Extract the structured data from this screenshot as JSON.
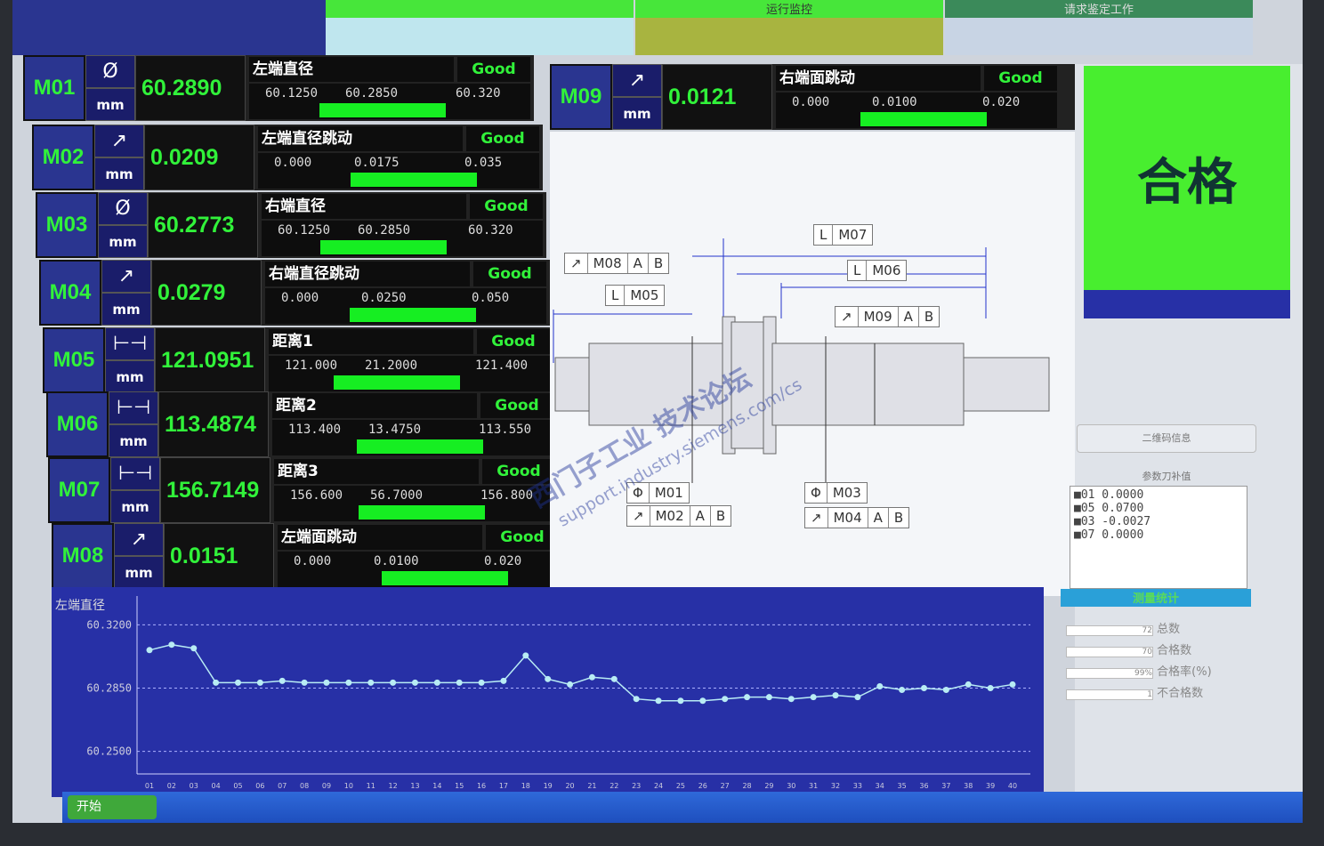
{
  "header": {
    "tabs": [
      "",
      "运行监控",
      "请求鉴定工作"
    ]
  },
  "measurements": [
    {
      "code": "M01",
      "symbol": "Ø",
      "unit": "mm",
      "value": "60.2890",
      "name": "左端直径",
      "status": "Good",
      "min": "60.1250",
      "mid": "60.2850",
      "max": "60.320",
      "indicator": 0.5
    },
    {
      "code": "M02",
      "symbol": "↗",
      "unit": "mm",
      "value": "0.0209",
      "name": "左端直径跳动",
      "status": "Good",
      "min": "0.000",
      "mid": "0.0175",
      "max": "0.035",
      "indicator": 0.58
    },
    {
      "code": "M03",
      "symbol": "Ø",
      "unit": "mm",
      "value": "60.2773",
      "name": "右端直径",
      "status": "Good",
      "min": "60.1250",
      "mid": "60.2850",
      "max": "60.320",
      "indicator": 0.46
    },
    {
      "code": "M04",
      "symbol": "↗",
      "unit": "mm",
      "value": "0.0279",
      "name": "右端直径跳动",
      "status": "Good",
      "min": "0.000",
      "mid": "0.0250",
      "max": "0.050",
      "indicator": 0.55
    },
    {
      "code": "M05",
      "symbol": "⊢⊣",
      "unit": "mm",
      "value": "121.0951",
      "name": "距离1",
      "status": "Good",
      "min": "121.000",
      "mid": "21.2000",
      "max": "121.400",
      "indicator": 0.48
    },
    {
      "code": "M06",
      "symbol": "⊢⊣",
      "unit": "mm",
      "value": "113.4874",
      "name": "距离2",
      "status": "Good",
      "min": "113.400",
      "mid": "13.4750",
      "max": "113.550",
      "indicator": 0.55
    },
    {
      "code": "M07",
      "symbol": "⊢⊣",
      "unit": "mm",
      "value": "156.7149",
      "name": "距离3",
      "status": "Good",
      "min": "156.600",
      "mid": "56.7000",
      "max": "156.800",
      "indicator": 0.55
    },
    {
      "code": "M08",
      "symbol": "↗",
      "unit": "mm",
      "value": "0.0151",
      "name": "左端面跳动",
      "status": "Good",
      "min": "0.000",
      "mid": "0.0100",
      "max": "0.020",
      "indicator": 0.62
    }
  ],
  "m09": {
    "code": "M09",
    "symbol": "↗",
    "unit": "mm",
    "value": "0.0121",
    "name": "右端面跳动",
    "status": "Good",
    "min": "0.000",
    "mid": "0.0100",
    "max": "0.020",
    "indicator": 0.55
  },
  "result": {
    "text": "合格"
  },
  "drawing_labels": {
    "m07": [
      "L",
      "M07"
    ],
    "m06": [
      "L",
      "M06"
    ],
    "m05": [
      "L",
      "M05"
    ],
    "m08": [
      "↗",
      "M08",
      "A",
      "B"
    ],
    "m09": [
      "↗",
      "M09",
      "A",
      "B"
    ],
    "m01": [
      "Φ",
      "M01"
    ],
    "m02": [
      "↗",
      "M02",
      "A",
      "B"
    ],
    "m03": [
      "Φ",
      "M03"
    ],
    "m04": [
      "↗",
      "M04",
      "A",
      "B"
    ]
  },
  "watermark": [
    "西门子工业 技术论坛",
    "support.industry.siemens.com/cs"
  ],
  "right_panel": {
    "qr_label": "二维码信息",
    "params_title": "参数刀补值",
    "params": [
      "■01  0.0000",
      "■05  0.0700",
      "■03  -0.0027",
      "■07  0.0000"
    ],
    "stats_title": "测量统计",
    "stats": [
      {
        "label": "总数",
        "value": "72"
      },
      {
        "label": "合格数",
        "value": "70"
      },
      {
        "label": "合格率(%)",
        "value": "99%"
      },
      {
        "label": "不合格数",
        "value": "1"
      }
    ]
  },
  "chart_data": {
    "type": "line",
    "title": "左端直径",
    "ylim": [
      60.24,
      60.33
    ],
    "yticks": [
      "60.3200",
      "60.2850",
      "60.2500"
    ],
    "x": [
      "01",
      "02",
      "03",
      "04",
      "05",
      "06",
      "07",
      "08",
      "09",
      "10",
      "11",
      "12",
      "13",
      "14",
      "15",
      "16",
      "17",
      "18",
      "19",
      "20",
      "21",
      "22",
      "23",
      "24",
      "25",
      "26",
      "27",
      "28",
      "29",
      "30",
      "31",
      "32",
      "33",
      "34",
      "35",
      "36",
      "37",
      "38",
      "39",
      "40"
    ],
    "series": [
      {
        "values": [
          60.306,
          60.309,
          60.307,
          60.288,
          60.288,
          60.288,
          60.289,
          60.288,
          60.288,
          60.288,
          60.288,
          60.288,
          60.288,
          60.288,
          60.288,
          60.288,
          60.289,
          60.303,
          60.29,
          60.287,
          60.291,
          60.29,
          60.279,
          60.278,
          60.278,
          60.278,
          60.279,
          60.28,
          60.28,
          60.279,
          60.28,
          60.281,
          60.28,
          60.286,
          60.284,
          60.285,
          60.284,
          60.287,
          60.285,
          60.287
        ]
      }
    ],
    "grid": true
  },
  "taskbar": {
    "start": "开始",
    "items": [
      "",
      "",
      "",
      "",
      ""
    ]
  }
}
